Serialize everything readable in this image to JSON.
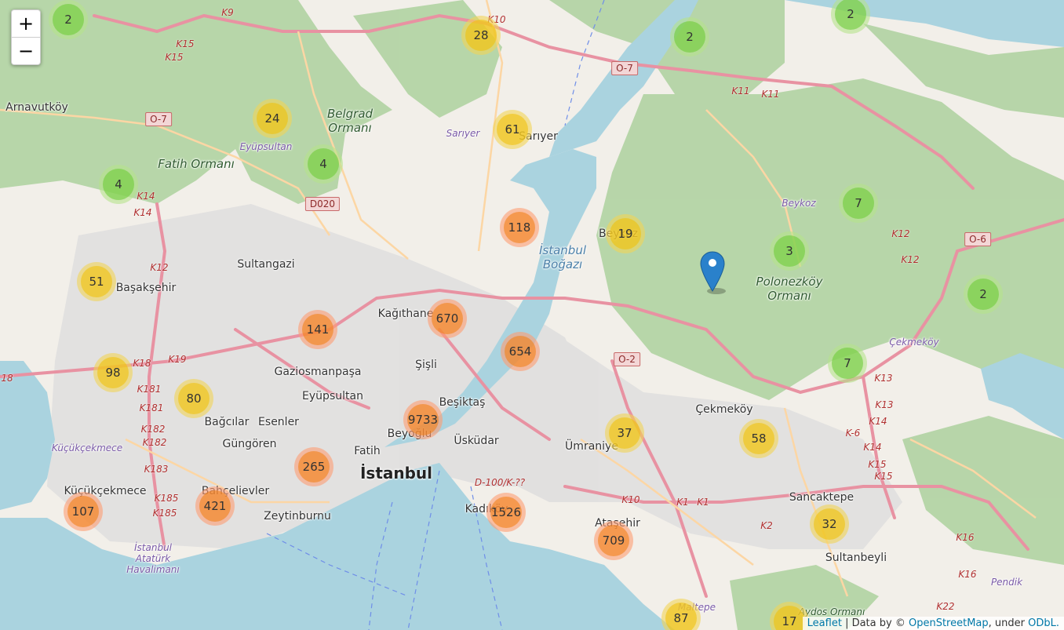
{
  "colors": {
    "water": "#aad3df",
    "forest": "#add19e",
    "land": "#f2efe9",
    "urban": "#e0dfdf",
    "motorway": "#e892a2",
    "primary": "#fcd6a4",
    "marker": "#2a81cb"
  },
  "zoom": {
    "in_label": "+",
    "out_label": "−"
  },
  "attribution": {
    "leaflet": "Leaflet",
    "sep1": " | Data by © ",
    "osm": "OpenStreetMap",
    "sep2": ", under ",
    "odbl": "ODbL."
  },
  "clusters": [
    {
      "label": "2",
      "size": "small"
    },
    {
      "label": "28",
      "size": "medium"
    },
    {
      "label": "2",
      "size": "small"
    },
    {
      "label": "2",
      "size": "small"
    },
    {
      "label": "24",
      "size": "medium"
    },
    {
      "label": "61",
      "size": "medium"
    },
    {
      "label": "4",
      "size": "small"
    },
    {
      "label": "4",
      "size": "small"
    },
    {
      "label": "7",
      "size": "small"
    },
    {
      "label": "118",
      "size": "large"
    },
    {
      "label": "19",
      "size": "medium"
    },
    {
      "label": "3",
      "size": "small"
    },
    {
      "label": "51",
      "size": "medium"
    },
    {
      "label": "2",
      "size": "small"
    },
    {
      "label": "141",
      "size": "large"
    },
    {
      "label": "670",
      "size": "large"
    },
    {
      "label": "654",
      "size": "large"
    },
    {
      "label": "98",
      "size": "medium"
    },
    {
      "label": "7",
      "size": "small"
    },
    {
      "label": "80",
      "size": "medium"
    },
    {
      "label": "9733",
      "size": "large"
    },
    {
      "label": "37",
      "size": "medium"
    },
    {
      "label": "58",
      "size": "medium"
    },
    {
      "label": "265",
      "size": "large"
    },
    {
      "label": "421",
      "size": "large"
    },
    {
      "label": "107",
      "size": "large"
    },
    {
      "label": "1526",
      "size": "large"
    },
    {
      "label": "32",
      "size": "medium"
    },
    {
      "label": "709",
      "size": "large"
    },
    {
      "label": "87",
      "size": "medium"
    },
    {
      "label": "17",
      "size": "medium"
    }
  ],
  "places": [
    "Arnavutköy",
    "Sultangazi",
    "Başakşehir",
    "Kağıthane",
    "Gaziosmanpaşa",
    "Eyüpsultan",
    "Şişli",
    "Beşiktaş",
    "Beyoğlu",
    "Bağcılar",
    "Esenler",
    "Güngören",
    "Fatih",
    "Üsküdar",
    "Ümraniye",
    "Çekmeköy",
    "Küçükçekmece",
    "Bahçelievler",
    "Zeytinburnu",
    "Kadıköy",
    "Ataşehir",
    "Sancaktepe",
    "Sultanbeyli",
    "Sarıyer",
    "Beykoz"
  ],
  "city": "İstanbul",
  "forests": [
    "Belgrad\nOrmanı",
    "Fatih Ormanı",
    "Polonezköy\nOrmanı",
    "İstanbul\nBoğazı",
    "Aydos Ormanı"
  ],
  "districts": [
    "Eyüpsultan",
    "Sarıyer",
    "Beykoz",
    "Çekmeköy",
    "Küçükçekmece",
    "İstanbul\nAtatürk\nHavalimanı",
    "Pendik",
    "Maltepe"
  ],
  "shields": [
    "O-7",
    "O-7",
    "D020",
    "O-2",
    "O-6"
  ],
  "road_refs": [
    "K9",
    "K10",
    "K15",
    "K15",
    "K11",
    "K11",
    "K14",
    "K14",
    "K12",
    "K12",
    "K12",
    "K18",
    "K19",
    "K181",
    "K181",
    "K182",
    "K182",
    "K183",
    "K185",
    "K185",
    "K13",
    "K13",
    "K14",
    "K-6",
    "K14",
    "K15",
    "K15",
    "K16",
    "K16",
    "K22",
    "K10",
    "K1",
    "K1",
    "K2",
    "D-100/K-??",
    "18"
  ]
}
